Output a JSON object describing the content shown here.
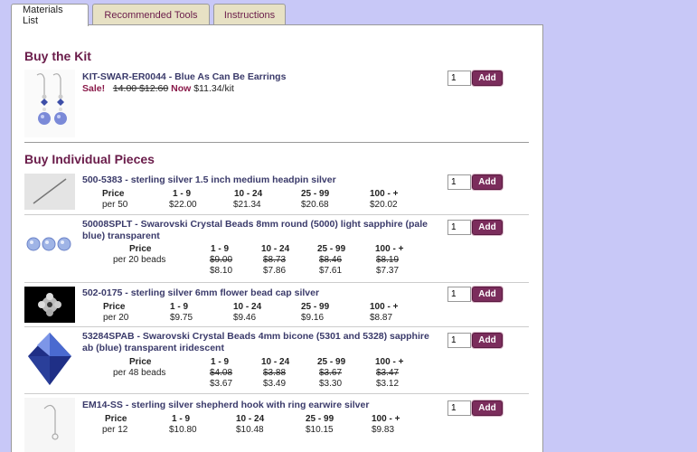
{
  "tabs": [
    {
      "label": "Materials List"
    },
    {
      "label": "Recommended Tools"
    },
    {
      "label": "Instructions"
    }
  ],
  "kit": {
    "heading": "Buy the Kit",
    "title": "KIT-SWAR-ER0044 - Blue As Can Be Earrings",
    "sale_label": "Sale!",
    "old_prices": "14.00 $12.60",
    "now_label": "Now",
    "now_price": "$11.34/kit",
    "qty": "1",
    "add_label": "Add"
  },
  "individual": {
    "heading": "Buy Individual Pieces",
    "items": [
      {
        "title": "500-5383 - sterling silver 1.5 inch medium headpin silver",
        "qty": "1",
        "add_label": "Add",
        "price_label": "Price",
        "unit": "per 50",
        "tiers": [
          "1 - 9",
          "10 - 24",
          "25 - 99",
          "100 - +"
        ],
        "old": [],
        "prices": [
          "$22.00",
          "$21.34",
          "$20.68",
          "$20.02"
        ]
      },
      {
        "title": "50008SPLT - Swarovski Crystal Beads 8mm round (5000) light sapphire (pale blue) transparent",
        "qty": "1",
        "add_label": "Add",
        "price_label": "Price",
        "unit": "per 20 beads",
        "tiers": [
          "1 - 9",
          "10 - 24",
          "25 - 99",
          "100 - +"
        ],
        "old": [
          "$9.00",
          "$8.73",
          "$8.46",
          "$8.19"
        ],
        "prices": [
          "$8.10",
          "$7.86",
          "$7.61",
          "$7.37"
        ]
      },
      {
        "title": "502-0175 - sterling silver 6mm flower bead cap silver",
        "qty": "1",
        "add_label": "Add",
        "price_label": "Price",
        "unit": "per 20",
        "tiers": [
          "1 - 9",
          "10 - 24",
          "25 - 99",
          "100 - +"
        ],
        "old": [],
        "prices": [
          "$9.75",
          "$9.46",
          "$9.16",
          "$8.87"
        ]
      },
      {
        "title": "53284SPAB - Swarovski Crystal Beads 4mm bicone (5301 and 5328) sapphire ab (blue) transparent iridescent",
        "qty": "1",
        "add_label": "Add",
        "price_label": "Price",
        "unit": "per 48 beads",
        "tiers": [
          "1 - 9",
          "10 - 24",
          "25 - 99",
          "100 - +"
        ],
        "old": [
          "$4.08",
          "$3.88",
          "$3.67",
          "$3.47"
        ],
        "prices": [
          "$3.67",
          "$3.49",
          "$3.30",
          "$3.12"
        ]
      },
      {
        "title": "EM14-SS - sterling silver shepherd hook with ring earwire silver",
        "qty": "1",
        "add_label": "Add",
        "price_label": "Price",
        "unit": "per 12",
        "tiers": [
          "1 - 9",
          "10 - 24",
          "25 - 99",
          "100 - +"
        ],
        "old": [],
        "prices": [
          "$10.80",
          "$10.48",
          "$10.15",
          "$9.83"
        ]
      }
    ]
  },
  "colors": {
    "background": "#c8c8f7",
    "heading": "#6a1c4a",
    "add_button": "#7b2d5c",
    "tab_inactive": "#e7e1c4"
  }
}
